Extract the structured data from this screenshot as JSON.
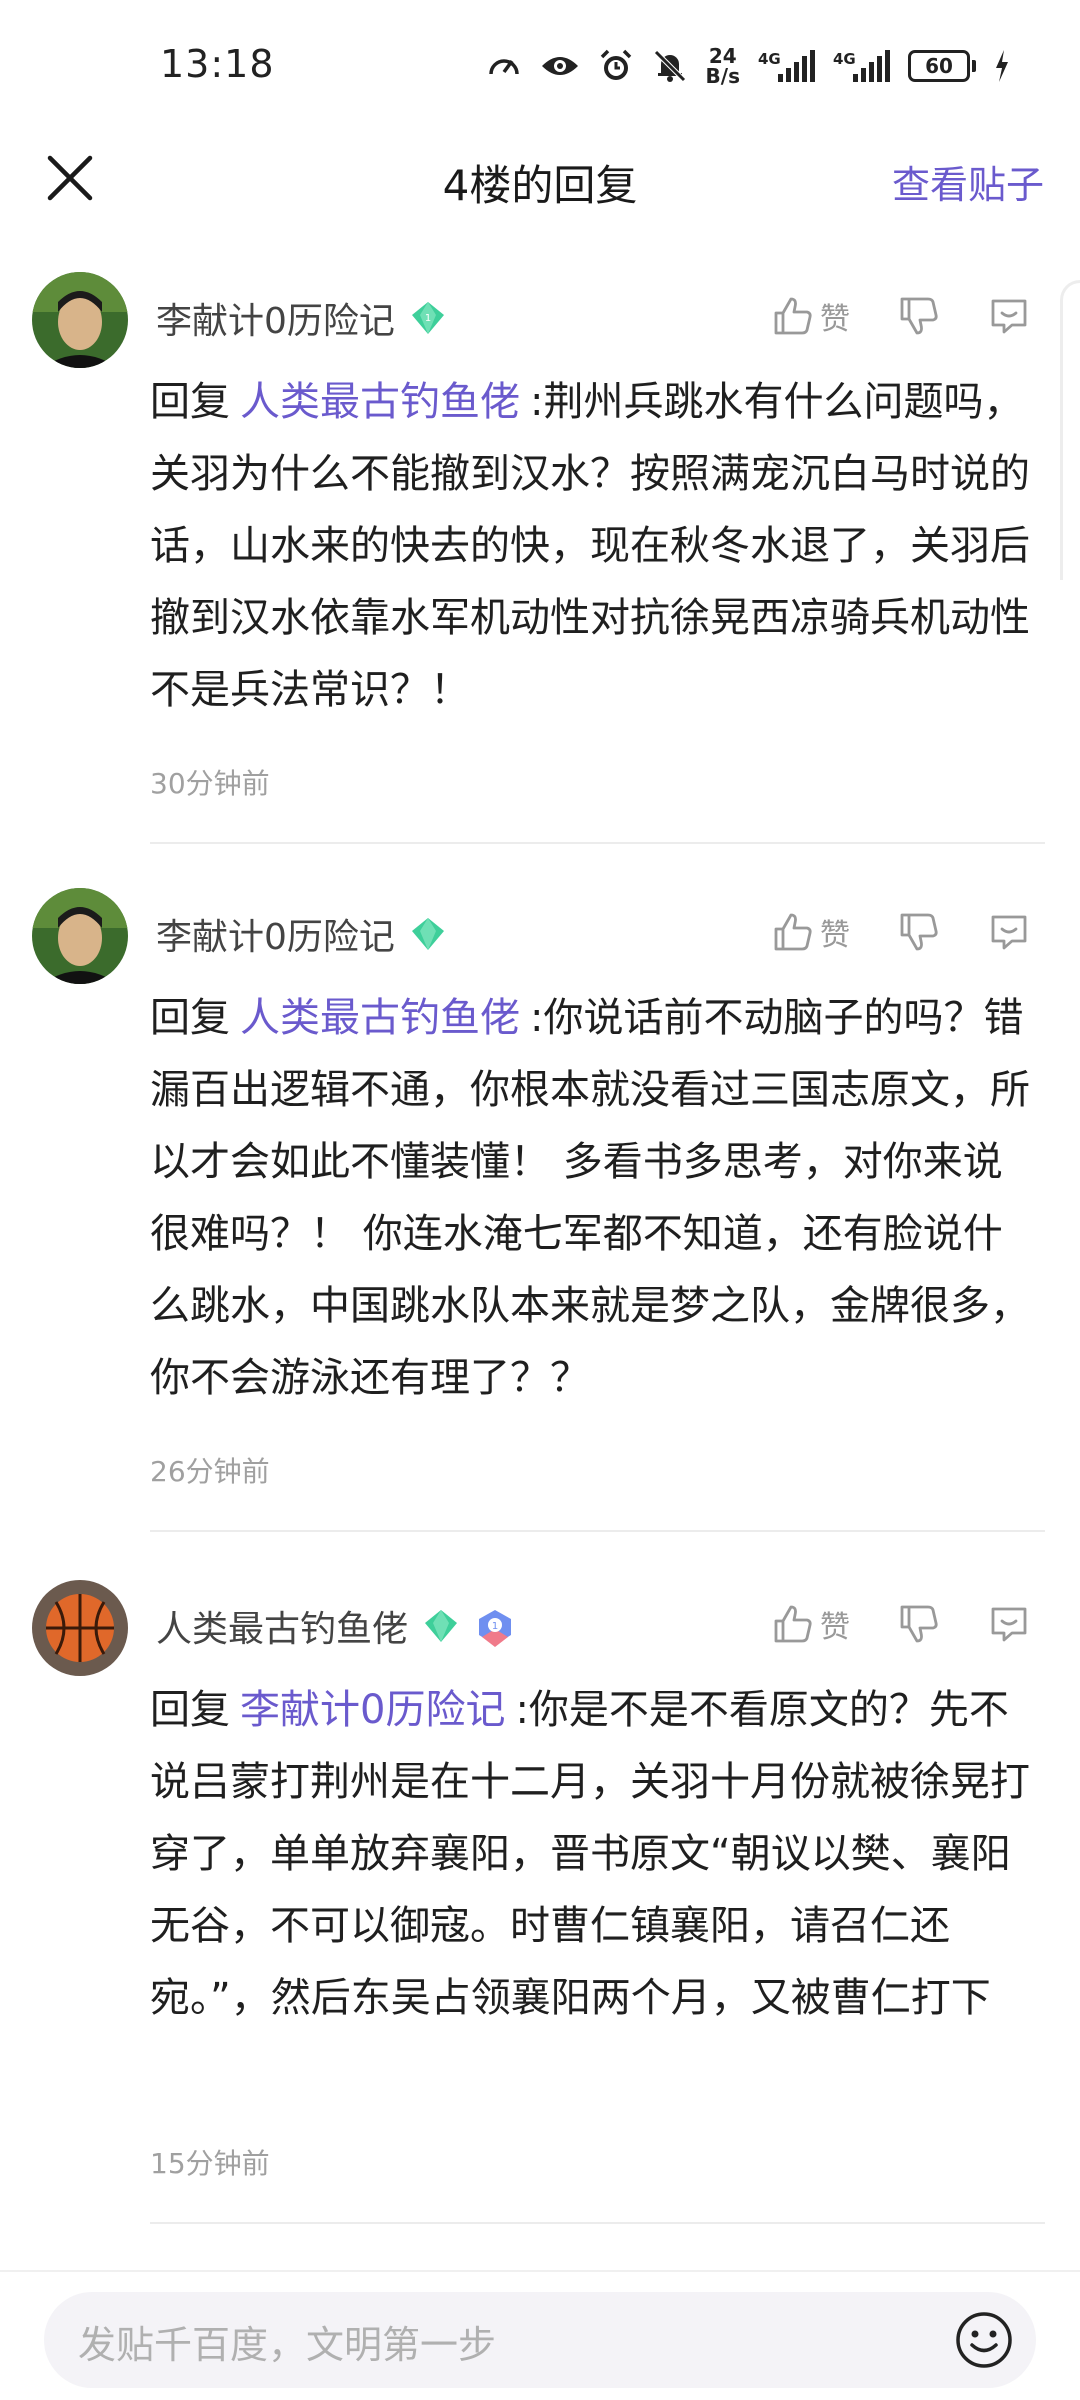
{
  "status_bar": {
    "time": "13:18",
    "net_speed_value": "24",
    "net_speed_unit": "B/s",
    "signal1_tag": "4G",
    "signal2_tag": "4G",
    "battery": "60",
    "icons": [
      "speedometer-icon",
      "eye-icon",
      "alarm-icon",
      "mute-bell-icon",
      "signal-icon",
      "signal-icon",
      "battery-icon",
      "charging-icon"
    ]
  },
  "header": {
    "title": "4楼的回复",
    "view_post": "查看贴子"
  },
  "comments": [
    {
      "username": "李献计0历险记",
      "like_label": "赞",
      "reply_prefix": "回复",
      "mention": "人类最古钓鱼佬",
      "text": ":荆州兵跳水有什么问题吗，关羽为什么不能撤到汉水？按照满宠沉白马时说的话，山水来的快去的快，现在秋冬水退了，关羽后撤到汉水依靠水军机动性对抗徐晃西凉骑兵机动性不是兵法常识？！",
      "time": "30分钟前"
    },
    {
      "username": "李献计0历险记",
      "like_label": "赞",
      "reply_prefix": "回复",
      "mention": "人类最古钓鱼佬",
      "text": ":你说话前不动脑子的吗？错漏百出逻辑不通，你根本就没看过三国志原文，所以才会如此不懂装懂！ 多看书多思考，对你来说很难吗？！ 你连水淹七军都不知道，还有脸说什么跳水，中国跳水队本来就是梦之队，金牌很多，你不会游泳还有理了？？",
      "time": "26分钟前"
    },
    {
      "username": "人类最古钓鱼佬",
      "like_label": "赞",
      "reply_prefix": "回复",
      "mention": "李献计0历险记",
      "text": ":你是不是不看原文的？先不说吕蒙打荆州是在十二月，关羽十月份就被徐晃打穿了，单单放弃襄阳，晋书原文“朝议以樊、襄阳无谷，不可以御寇。时曹仁镇襄阳，请召仁还宛。”，然后东吴占领襄阳两个月，又被曹仁打下",
      "time": "15分钟前"
    }
  ],
  "input": {
    "placeholder": "发贴千百度，文明第一步"
  },
  "colors": {
    "accent": "#6a5acd",
    "badge_green": "#3ecf9a",
    "muted": "#999999"
  }
}
